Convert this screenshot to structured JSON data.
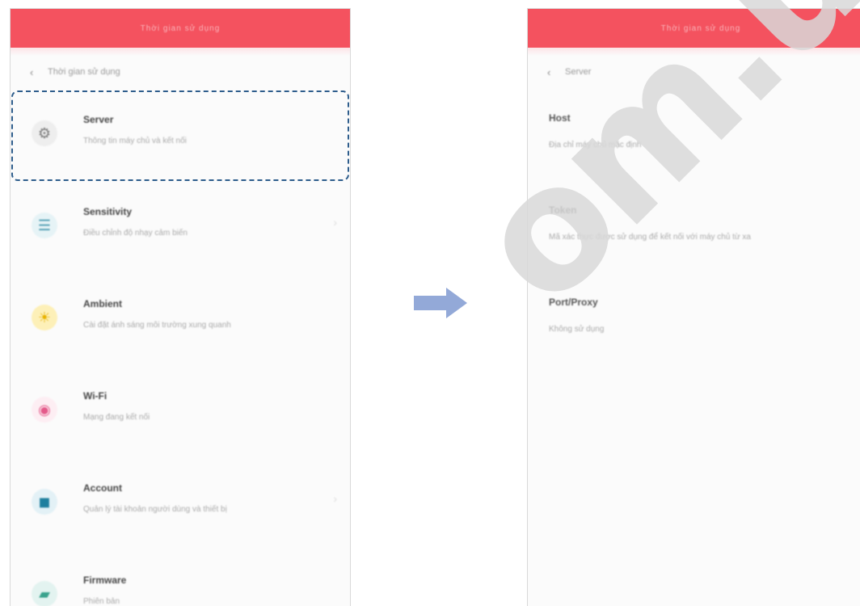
{
  "left_screen": {
    "header_title": "Thời gian sử dụng",
    "back_label": "Thời gian sử dụng",
    "items": [
      {
        "title": "Server",
        "description": "Thông tin máy chủ và kết nối",
        "icon": "gear-icon",
        "icon_bg": "#eeeeee",
        "icon_color": "#777777",
        "icon_glyph": "⚙"
      },
      {
        "title": "Sensitivity",
        "description": "Điều chỉnh độ nhạy cảm biến",
        "icon": "sliders-icon",
        "icon_bg": "#e6f3f6",
        "icon_color": "#4a9bb0",
        "icon_glyph": "☰"
      },
      {
        "title": "Ambient",
        "description": "Cài đặt ánh sáng môi trường xung quanh",
        "icon": "sun-icon",
        "icon_bg": "#fdf0b8",
        "icon_color": "#e8b200",
        "icon_glyph": "☀"
      },
      {
        "title": "Wi-Fi",
        "description": "Mạng đang kết nối",
        "icon": "wifi-icon",
        "icon_bg": "#fdeef3",
        "icon_color": "#e45a8a",
        "icon_glyph": "◉"
      },
      {
        "title": "Account",
        "description": "Quản lý tài khoản người dùng và thiết bị",
        "icon": "camera-icon",
        "icon_bg": "#e3f1f6",
        "icon_color": "#1f7f9e",
        "icon_glyph": "◼"
      },
      {
        "title": "Firmware",
        "description": "Phiên bản",
        "icon": "folder-icon",
        "icon_bg": "#e3f3f0",
        "icon_color": "#3aa38d",
        "icon_glyph": "▰"
      }
    ]
  },
  "right_screen": {
    "header_title": "Thời gian sử dụng",
    "back_label": "Server",
    "fields": [
      {
        "label": "Host",
        "value": "Địa chỉ máy chủ mặc định"
      },
      {
        "label": "Token",
        "value": "Mã xác thực được sử dụng để kết nối với máy chủ từ xa"
      },
      {
        "label": "Port/Proxy",
        "value": "Không sử dụng"
      }
    ]
  },
  "watermark": "om.ua",
  "colors": {
    "header": "#f4525f",
    "highlight_border": "#2e5d8c",
    "arrow": "#93a9d8"
  }
}
